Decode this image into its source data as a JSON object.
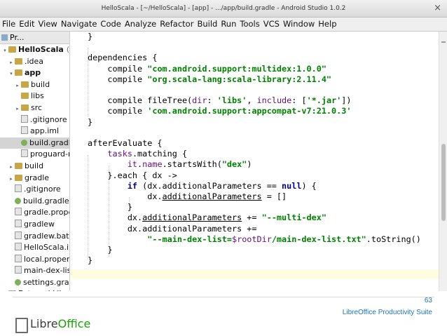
{
  "window": {
    "title": "HelloScala - [~/HelloScala] - [app] - .../app/build.gradle - Android Studio 1.0.2",
    "close_glyph": "×"
  },
  "menu": [
    "File",
    "Edit",
    "View",
    "Navigate",
    "Code",
    "Analyze",
    "Refactor",
    "Build",
    "Run",
    "Tools",
    "VCS",
    "Window",
    "Help"
  ],
  "project_panel": {
    "header": "Pr...",
    "tree": [
      {
        "label": "HelloScala",
        "suffix": "(~",
        "indent": 0,
        "arrow": "▾",
        "icon": "folder",
        "bold": true
      },
      {
        "label": ".idea",
        "indent": 1,
        "arrow": "▸",
        "icon": "folder"
      },
      {
        "label": "app",
        "indent": 1,
        "arrow": "▾",
        "icon": "folder",
        "bold": true
      },
      {
        "label": "build",
        "indent": 2,
        "arrow": "▸",
        "icon": "folder"
      },
      {
        "label": "libs",
        "indent": 2,
        "arrow": "",
        "icon": "folder"
      },
      {
        "label": "src",
        "indent": 2,
        "arrow": "▸",
        "icon": "folder"
      },
      {
        "label": ".gitignore",
        "indent": 2,
        "arrow": "",
        "icon": "file"
      },
      {
        "label": "app.iml",
        "indent": 2,
        "arrow": "",
        "icon": "file"
      },
      {
        "label": "build.gradle",
        "indent": 2,
        "arrow": "",
        "icon": "gradle",
        "selected": true
      },
      {
        "label": "proguard-rules.pro",
        "indent": 2,
        "arrow": "",
        "icon": "file"
      },
      {
        "label": "build",
        "indent": 1,
        "arrow": "▸",
        "icon": "folder"
      },
      {
        "label": "gradle",
        "indent": 1,
        "arrow": "▸",
        "icon": "folder"
      },
      {
        "label": ".gitignore",
        "indent": 1,
        "arrow": "",
        "icon": "file"
      },
      {
        "label": "build.gradle",
        "indent": 1,
        "arrow": "",
        "icon": "gradle"
      },
      {
        "label": "gradle.properties",
        "indent": 1,
        "arrow": "",
        "icon": "file"
      },
      {
        "label": "gradlew",
        "indent": 1,
        "arrow": "",
        "icon": "file"
      },
      {
        "label": "gradlew.bat",
        "indent": 1,
        "arrow": "",
        "icon": "file"
      },
      {
        "label": "HelloScala.iml",
        "indent": 1,
        "arrow": "",
        "icon": "file"
      },
      {
        "label": "local.properties",
        "indent": 1,
        "arrow": "",
        "icon": "file"
      },
      {
        "label": "main-dex-list.txt",
        "indent": 1,
        "arrow": "",
        "icon": "file"
      },
      {
        "label": "settings.gradle",
        "indent": 1,
        "arrow": "",
        "icon": "gradle"
      },
      {
        "label": "External Libraries",
        "indent": 0,
        "arrow": "▸",
        "icon": "folder-blue"
      }
    ]
  },
  "editor": {
    "lines": [
      [
        {
          "t": "}"
        }
      ],
      [
        {
          "t": ""
        }
      ],
      [
        {
          "t": "dependencies {"
        }
      ],
      [
        {
          "t": "    compile "
        },
        {
          "t": "\"com.android.support:multidex:1.0.0\"",
          "c": "str"
        }
      ],
      [
        {
          "t": "    compile "
        },
        {
          "t": "\"org.scala-lang:scala-library:2.11.4\"",
          "c": "str"
        }
      ],
      [
        {
          "t": ""
        }
      ],
      [
        {
          "t": "    compile fileTree("
        },
        {
          "t": "dir",
          "c": "prop"
        },
        {
          "t": ": "
        },
        {
          "t": "'libs'",
          "c": "str"
        },
        {
          "t": ", "
        },
        {
          "t": "include",
          "c": "prop"
        },
        {
          "t": ": ["
        },
        {
          "t": "'*.jar'",
          "c": "str"
        },
        {
          "t": "])"
        }
      ],
      [
        {
          "t": "    compile "
        },
        {
          "t": "'com.android.support:appcompat-v7:21.0.3'",
          "c": "str"
        }
      ],
      [
        {
          "t": "}"
        }
      ],
      [
        {
          "t": ""
        }
      ],
      [
        {
          "t": "afterEvaluate {"
        }
      ],
      [
        {
          "t": "    "
        },
        {
          "t": "tasks",
          "c": "prop"
        },
        {
          "t": ".matching {"
        }
      ],
      [
        {
          "t": "        "
        },
        {
          "t": "it",
          "c": "prop"
        },
        {
          "t": "."
        },
        {
          "t": "name",
          "c": "prop"
        },
        {
          "t": ".startsWith("
        },
        {
          "t": "\"dex\"",
          "c": "str"
        },
        {
          "t": ")"
        }
      ],
      [
        {
          "t": "    }.each { dx ->"
        }
      ],
      [
        {
          "t": "        "
        },
        {
          "t": "if",
          "c": "kw"
        },
        {
          "t": " (dx.additionalParameters == "
        },
        {
          "t": "null",
          "c": "kw"
        },
        {
          "t": ") {"
        }
      ],
      [
        {
          "t": "            dx."
        },
        {
          "t": "additionalParameters",
          "c": "ul"
        },
        {
          "t": " = []"
        }
      ],
      [
        {
          "t": "        }"
        }
      ],
      [
        {
          "t": "        dx."
        },
        {
          "t": "additionalParameters",
          "c": "ul"
        },
        {
          "t": " += "
        },
        {
          "t": "\"--multi-dex\"",
          "c": "str"
        }
      ],
      [
        {
          "t": "        dx.additionalParameters +="
        }
      ],
      [
        {
          "t": "            "
        },
        {
          "t": "\"--main-dex-list=",
          "c": "str"
        },
        {
          "t": "$rootDir",
          "c": "prop"
        },
        {
          "t": "/main-dex-list.txt\"",
          "c": "str"
        },
        {
          "t": ".toString()"
        }
      ],
      [
        {
          "t": "    }"
        }
      ],
      [
        {
          "t": "}"
        }
      ]
    ]
  },
  "footer": {
    "logo_prefix": "Libre",
    "logo_suffix": "Office",
    "page_number": "63",
    "suite_name": "LibreOffice Productivity Suite"
  }
}
